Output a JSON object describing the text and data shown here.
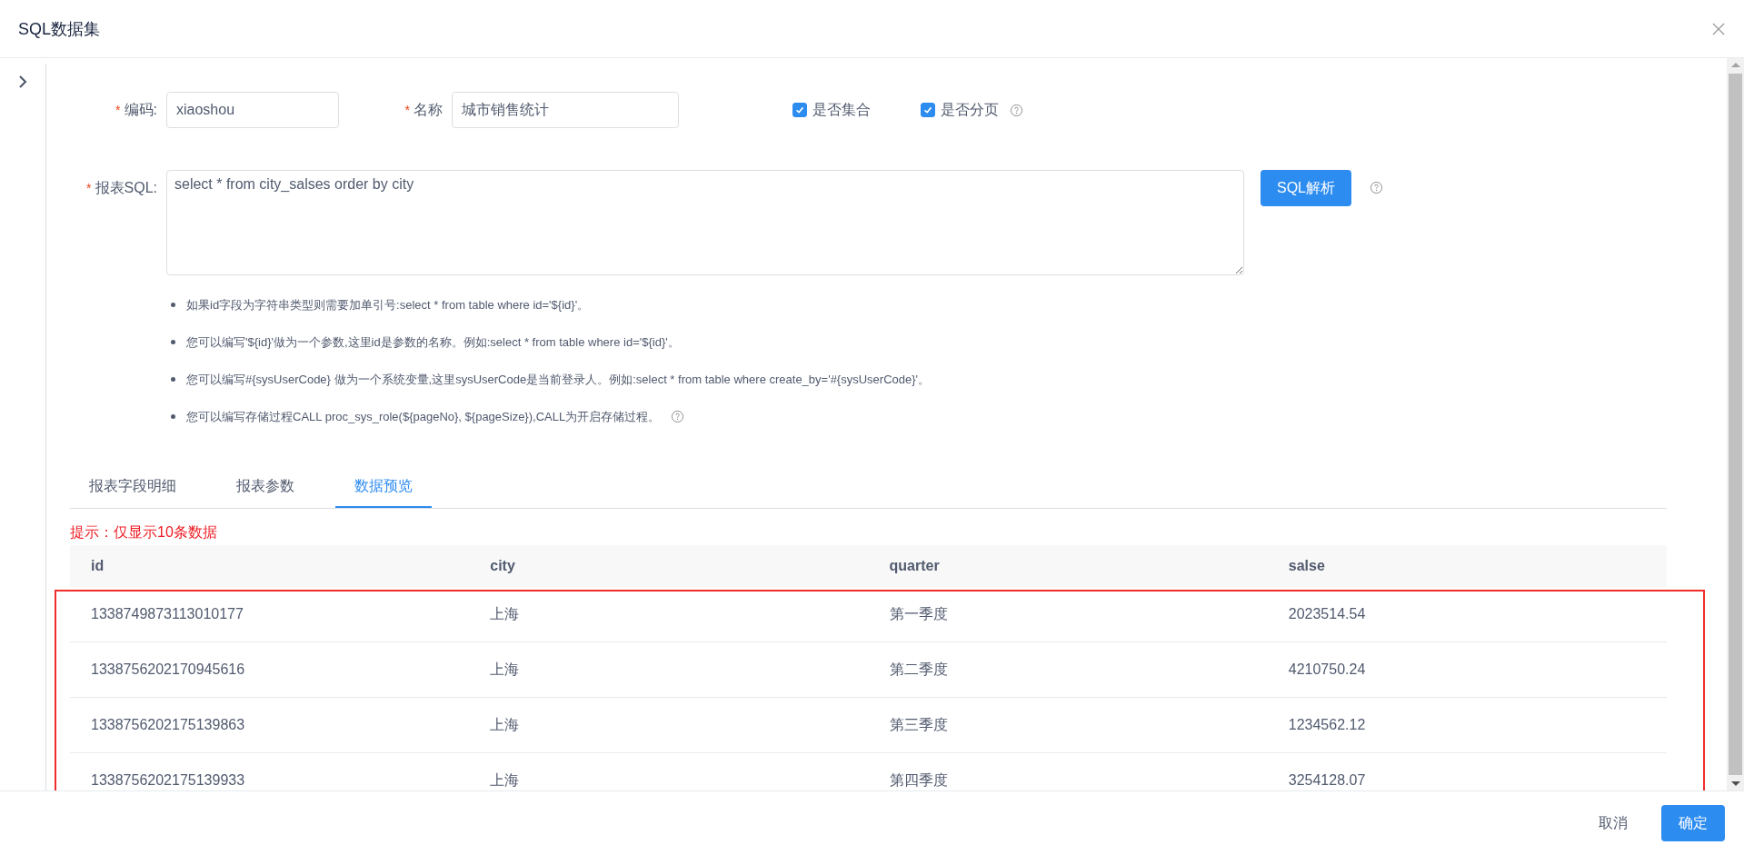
{
  "window": {
    "title": "SQL数据集"
  },
  "form": {
    "fields": [
      {
        "mark": "*",
        "label": "编码:",
        "value": "xiaoshou"
      },
      {
        "mark": "*",
        "label": "名称",
        "value": "城市销售统计"
      }
    ],
    "checkboxes": [
      {
        "label": "是否集合",
        "checked": true,
        "help": false
      },
      {
        "label": "是否分页",
        "checked": true,
        "help": true
      }
    ],
    "sql": {
      "mark": "*",
      "label": "报表SQL:",
      "value": "select * from city_salses order by city",
      "button": "SQL解析"
    },
    "notes": [
      {
        "text": "如果id字段为字符串类型则需要加单引号:select * from table where id='${id}'。",
        "help": false
      },
      {
        "text": "您可以编写'${id}'做为一个参数,这里id是参数的名称。例如:select * from table where id='${id}'。",
        "help": false
      },
      {
        "text": "您可以编写#{sysUserCode} 做为一个系统变量,这里sysUserCode是当前登录人。例如:select * from table where create_by='#{sysUserCode}'。",
        "help": false
      },
      {
        "text": "您可以编写存储过程CALL proc_sys_role(${pageNo}, ${pageSize}),CALL为开启存储过程。",
        "help": true
      }
    ]
  },
  "tabs": [
    {
      "label": "报表字段明细",
      "selected": false
    },
    {
      "label": "报表参数",
      "selected": false
    },
    {
      "label": "数据预览",
      "selected": true
    }
  ],
  "hint": "提示：仅显示10条数据",
  "table": {
    "columns": [
      "id",
      "city",
      "quarter",
      "salse"
    ],
    "rows": [
      [
        "1338749873113010177",
        "上海",
        "第一季度",
        "2023514.54"
      ],
      [
        "1338756202170945616",
        "上海",
        "第二季度",
        "4210750.24"
      ],
      [
        "1338756202175139863",
        "上海",
        "第三季度",
        "1234562.12"
      ],
      [
        "1338756202175139933",
        "上海",
        "第四季度",
        "3254128.07"
      ]
    ],
    "highlighted": true
  },
  "footer": {
    "buttons": [
      {
        "label": "取消",
        "kind": "plain"
      },
      {
        "label": "确定",
        "kind": "primary"
      }
    ]
  }
}
